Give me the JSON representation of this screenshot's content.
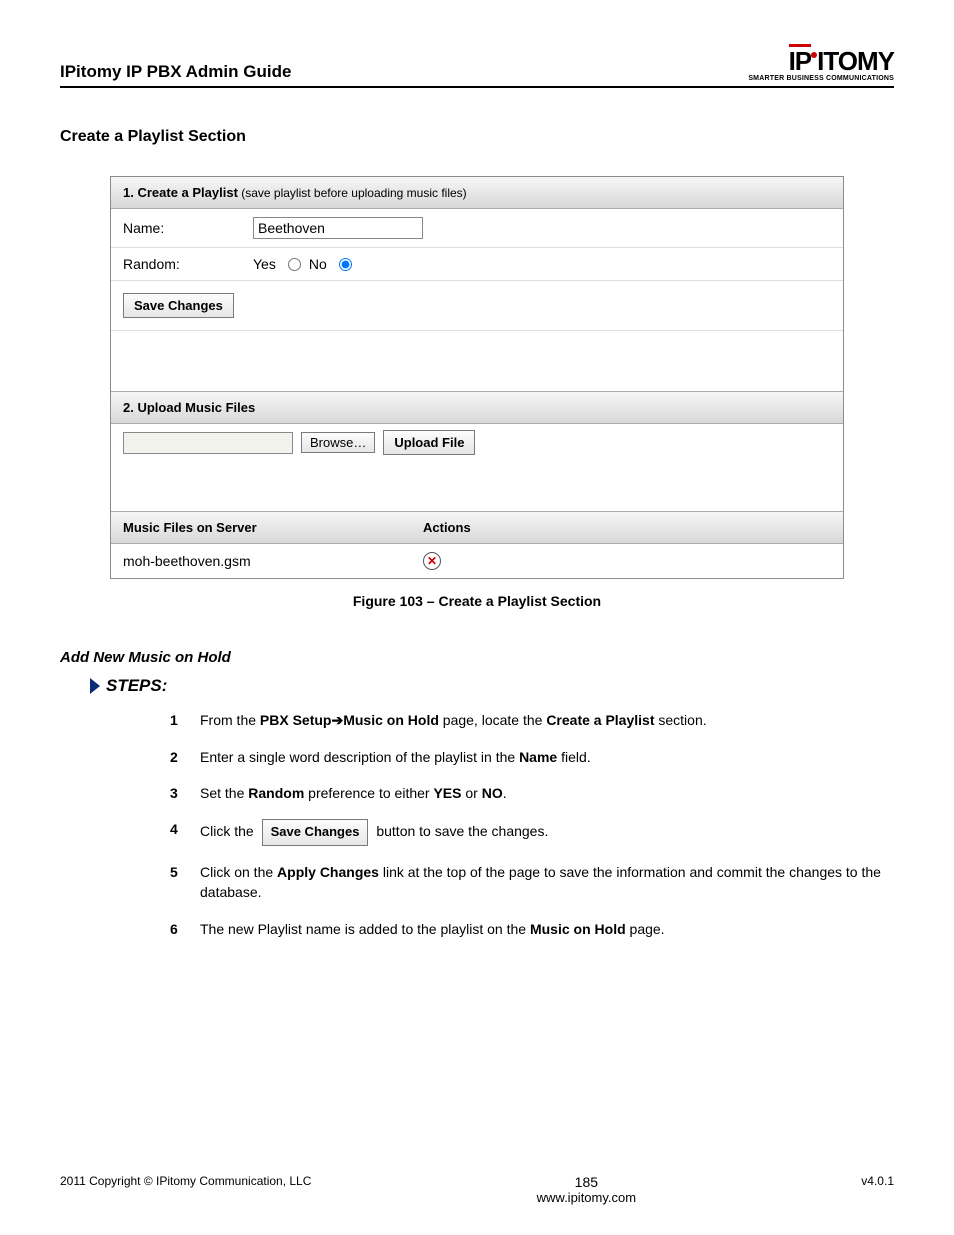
{
  "header": {
    "title": "IPitomy IP PBX Admin Guide",
    "logo_main_1": "IP",
    "logo_main_2": "ITOMY",
    "logo_tag": "SMARTER BUSINESS COMMUNICATIONS"
  },
  "section_title": "Create a Playlist Section",
  "panel1": {
    "header_bold": "1. Create a Playlist",
    "header_hint": " (save playlist before uploading music files)",
    "name_label": "Name:",
    "name_value": "Beethoven",
    "random_label": "Random:",
    "yes_label": "Yes",
    "no_label": "No",
    "random_selected": "no",
    "save_label": "Save Changes"
  },
  "panel2": {
    "header": "2. Upload Music Files",
    "browse_label": "Browse…",
    "upload_label": "Upload File"
  },
  "table": {
    "col_file": "Music Files on Server",
    "col_actions": "Actions",
    "rows": [
      {
        "file": "moh-beethoven.gsm"
      }
    ]
  },
  "figure_caption": "Figure 103 – Create a Playlist Section",
  "subsection": "Add New Music on Hold",
  "steps_label": "STEPS:",
  "steps": {
    "s1_a": "From the ",
    "s1_b1": "PBX Setup",
    "s1_b2": "Music on Hold",
    "s1_c": " page, locate the ",
    "s1_d": "Create a Playlist",
    "s1_e": " section.",
    "s2_a": "Enter a single word description of the playlist in the ",
    "s2_b": "Name",
    "s2_c": " field.",
    "s3_a": "Set the ",
    "s3_b": "Random",
    "s3_c": " preference to either ",
    "s3_d": "YES",
    "s3_e": " or ",
    "s3_f": "NO",
    "s3_g": ".",
    "s4_a": "Click the ",
    "s4_btn": "Save Changes",
    "s4_b": " button to save the changes.",
    "s5_a": "Click on the ",
    "s5_b": "Apply Changes",
    "s5_c": " link at the top of the page to save the information and commit the changes to the database.",
    "s6_a": "The new Playlist name is added to the playlist on the ",
    "s6_b": "Music on Hold",
    "s6_c": " page."
  },
  "footer": {
    "left": "2011 Copyright © IPitomy Communication, LLC",
    "page_num": "185",
    "url": "www.ipitomy.com",
    "right": "v4.0.1"
  }
}
